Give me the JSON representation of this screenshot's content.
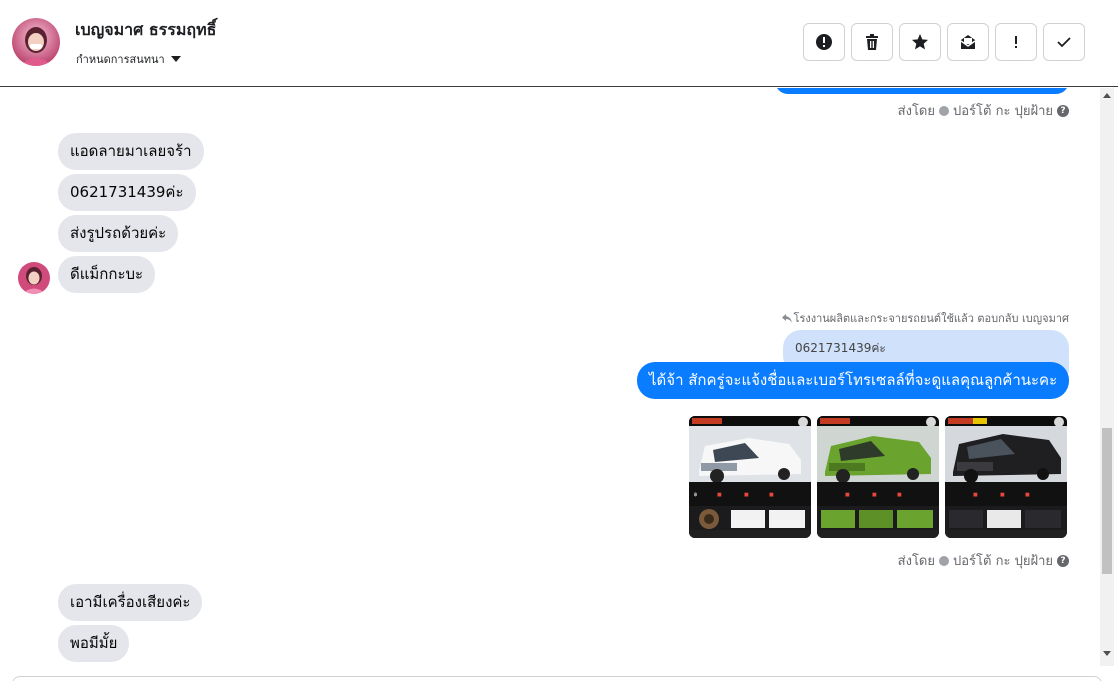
{
  "header": {
    "name": "เบญจมาศ ธรรมฤทธิ์",
    "status_label": "กำหนดการสนทนา",
    "actions": [
      {
        "id": "report",
        "icon": "alert-circle-icon"
      },
      {
        "id": "delete",
        "icon": "trash-icon"
      },
      {
        "id": "star",
        "icon": "star-icon"
      },
      {
        "id": "mark-unread",
        "icon": "envelope-open-icon"
      },
      {
        "id": "important",
        "icon": "exclamation-icon"
      },
      {
        "id": "done",
        "icon": "check-icon"
      }
    ]
  },
  "thread": {
    "sent_by_top": "ส่งโดย",
    "sender_top": "ปอร์โต้ กะ ปุยฝ้าย",
    "incoming_1": [
      "แอดลายมาเลยจร้า",
      "0621731439ค่ะ",
      "ส่งรูปรถด้วยค่ะ",
      "ดีแม็กกะบะ"
    ],
    "reply_meta": "โรงงานผลิตและกระจายรถยนต์ใช้แล้ว ตอบกลับ เบญจมาศ",
    "quoted_text": "0621731439ค่ะ",
    "outgoing_text": "ได้จ้า สักครู่จะแจ้งชื่อและเบอร์โทรเซลล์ที่จะดูแลคุณลูกค้านะคะ",
    "photos": [
      {
        "name": "white-pickup-photo",
        "color": "#ffffff"
      },
      {
        "name": "green-pickup-photo",
        "color": "#6aa32e"
      },
      {
        "name": "black-pickup-photo",
        "color": "#1f1f22"
      }
    ],
    "sent_by_bottom": "ส่งโดย",
    "sender_bottom": "ปอร์โต้ กะ ปุยฝ้าย",
    "incoming_2": [
      "เอามีเครื่องเสียงค่ะ",
      "พอมีมั้ย"
    ]
  },
  "colors": {
    "accent": "#0a7cff",
    "incoming_bubble": "#e4e6eb",
    "quoted_bubble": "#cfe1fb"
  }
}
